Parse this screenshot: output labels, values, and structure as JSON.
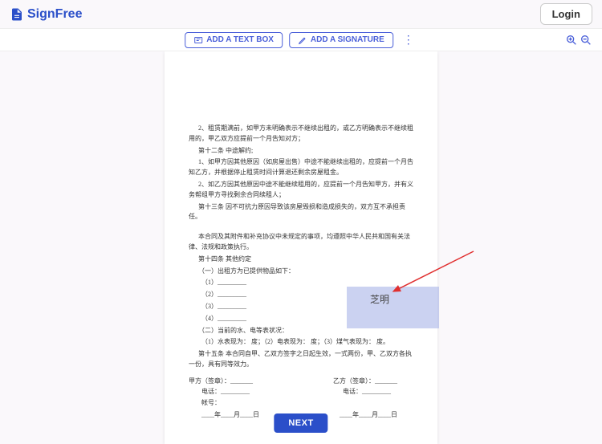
{
  "header": {
    "app_name": "SignFree",
    "login": "Login"
  },
  "toolbar": {
    "add_text": "ADD A TEXT BOX",
    "add_sig": "ADD A SIGNATURE"
  },
  "doc": {
    "p1": "2、租赁期满前，如甲方未明确表示不继续出租的，或乙方明确表示不继续租用的，甲乙双方应提前一个月告知对方；",
    "p2": "第十二条  中途解约;",
    "p3": "1、如甲方因其他原因（如房屋出售）中途不能继续出租的，应提前一个月告知乙方，并根据停止租赁时间计算退还剩余房屋租金。",
    "p4": "2、如乙方因其他原因中途不能继续租用的，应提前一个月告知甲方，并有义务帮组甲方寻找剩余合同续租人；",
    "p5": "第十三条  因不可抗力原因导致该房屋毁损和造成损失的，双方互不承担责任。",
    "p6": "本合同及其附件和补充协议中未规定的事项，均遵照中华人民共和国有关法律、法规和政策执行。",
    "p7": "第十四条   其他约定",
    "p8": "（一）出租方为已提供物品如下：",
    "p8a": "（1）_________",
    "p8b": "（2）_________",
    "p8c": "（3）_________",
    "p8d": "（4）_________",
    "p9": "（二）当前的水、电等表状况：",
    "p10": "（1）水表现为：          度；（2）电表现为：          度；（3）煤气表现为：          度。",
    "p11": "第十五条  本合同自甲、乙双方签字之日起生效，一式两份，甲、乙双方各执一份，具有同等效力。",
    "l1": "甲方（签章）：_______",
    "l2": "乙方（签章）：_______",
    "l3": "电话：_________",
    "l4": "电话：_________",
    "l5": "帐号：",
    "l6": "____年____月____日",
    "l7": "____年____月____日",
    "signature": "芝明"
  },
  "footer": {
    "next": "NEXT"
  }
}
